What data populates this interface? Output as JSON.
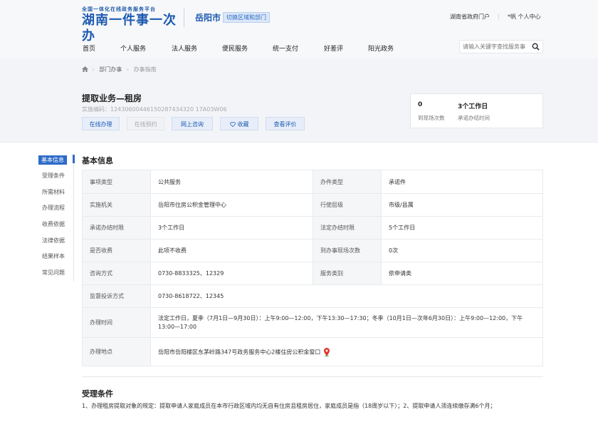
{
  "header": {
    "slogan": "全国一体化在线政务服务平台",
    "brand": "湖南一件事一次办",
    "city": "岳阳市",
    "switch_label": "切换区域和部门",
    "gov_portal": "湖南省政府门户",
    "user_label": "*帆 个人中心"
  },
  "nav": {
    "items": [
      "首页",
      "个人服务",
      "法人服务",
      "便民服务",
      "统一支付",
      "好差评",
      "阳光政务"
    ],
    "search_placeholder": "请输入关键字查找服务事"
  },
  "breadcrumb": [
    "部门办事",
    "办事指南"
  ],
  "item": {
    "title": "提取业务—租房",
    "code": "实施编码：12430600446150287434320 17A03W06",
    "buttons": [
      "在线办理",
      "在线预约",
      "网上咨询",
      "收藏",
      "查看评价"
    ]
  },
  "stats": {
    "visits_value": "0",
    "visits_label": "到现场次数",
    "time_value": "3个工作日",
    "time_label": "承诺办结时间"
  },
  "sidebar": {
    "items": [
      "基本信息",
      "受理条件",
      "所需材料",
      "办理流程",
      "收费依据",
      "法律依据",
      "结果样本",
      "常见问题"
    ]
  },
  "basic": {
    "heading": "基本信息",
    "rows": [
      {
        "l1": "事项类型",
        "v1": "公共服务",
        "l2": "办件类型",
        "v2": "承诺件"
      },
      {
        "l1": "实施机关",
        "v1": "岳阳市住房公积金管理中心",
        "l2": "行使层级",
        "v2": "市级/县属"
      },
      {
        "l1": "承诺办结时限",
        "v1": "3个工作日",
        "l2": "法定办结时限",
        "v2": "5个工作日"
      },
      {
        "l1": "是否收费",
        "v1": "此项不收费",
        "l2": "到办事现场次数",
        "v2": "0次"
      },
      {
        "l1": "咨询方式",
        "v1": "0730-8833325、12329",
        "l2": "服务类别",
        "v2": "依申请类"
      }
    ],
    "supervise_label": "监督投诉方式",
    "supervise_value": "0730-8618722、12345",
    "hours_label": "办理时间",
    "hours_value": "法定工作日，夏季（7月1日—9月30日）：上午9:00—12:00，下午13:30—17:30；冬季（10月1日—次年6月30日）：上午9:00—12:00，下午13:00—17:00",
    "address_label": "办理地点",
    "address_value": "岳阳市岳阳楼区东茅岭路347号政务服务中心2楼住房公积金窗口"
  },
  "conditions": {
    "heading": "受理条件",
    "text": "1、办理租房提取对象的规定：提取申请人家庭成员在本市行政区域内均无自有住房且租房居住，家庭成员是指（18周岁以下）；2、提取申请人须连续缴存满6个月；"
  },
  "colors": {
    "accent": "#2d6bc7",
    "brand": "#1d5ab0"
  }
}
